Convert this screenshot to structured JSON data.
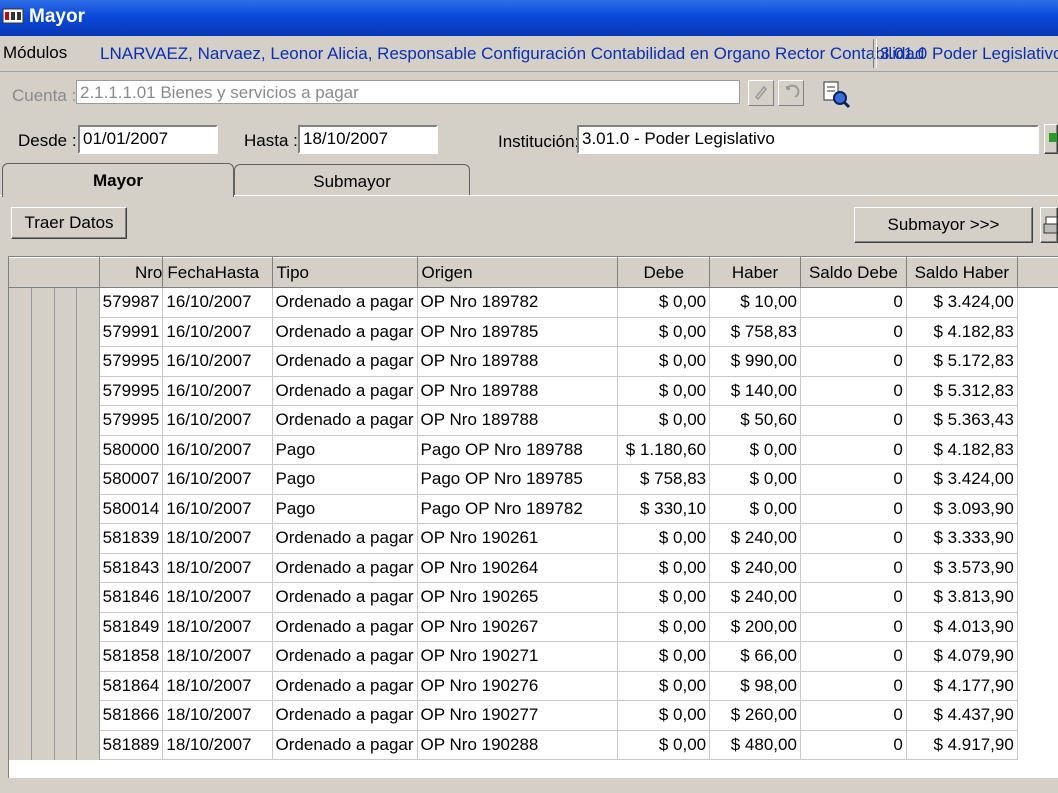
{
  "window": {
    "title": "Mayor"
  },
  "modules": {
    "label": "Módulos",
    "user": "LNARVAEZ, Narvaez, Leonor Alicia, Responsable Configuración Contabilidad en Organo Rector Contabilidad",
    "org": "3.01.0 Poder Legislativo,"
  },
  "cuenta": {
    "label": "Cuenta :",
    "value": "2.1.1.1.01 Bienes y servicios a pagar"
  },
  "filters": {
    "desde_label": "Desde :",
    "desde_value": "01/01/2007",
    "hasta_label": "Hasta :",
    "hasta_value": "18/10/2007",
    "institucion_label": "Institución:",
    "institucion_value": "3.01.0 - Poder Legislativo"
  },
  "tabs": [
    {
      "label": "Mayor"
    },
    {
      "label": "Submayor"
    }
  ],
  "buttons": {
    "traer_datos": "Traer Datos",
    "submayor": "Submayor >>>"
  },
  "table": {
    "columns": [
      "Nro",
      "FechaHasta",
      "Tipo",
      "Origen",
      "Debe",
      "Haber",
      "Saldo Debe",
      "Saldo Haber"
    ],
    "rows": [
      [
        "579987",
        "16/10/2007",
        "Ordenado a pagar",
        "OP Nro 189782",
        "$ 0,00",
        "$ 10,00",
        "0",
        "$ 3.424,00"
      ],
      [
        "579991",
        "16/10/2007",
        "Ordenado a pagar",
        "OP Nro 189785",
        "$ 0,00",
        "$ 758,83",
        "0",
        "$ 4.182,83"
      ],
      [
        "579995",
        "16/10/2007",
        "Ordenado a pagar",
        "OP Nro 189788",
        "$ 0,00",
        "$ 990,00",
        "0",
        "$ 5.172,83"
      ],
      [
        "579995",
        "16/10/2007",
        "Ordenado a pagar",
        "OP Nro 189788",
        "$ 0,00",
        "$ 140,00",
        "0",
        "$ 5.312,83"
      ],
      [
        "579995",
        "16/10/2007",
        "Ordenado a pagar",
        "OP Nro 189788",
        "$ 0,00",
        "$ 50,60",
        "0",
        "$ 5.363,43"
      ],
      [
        "580000",
        "16/10/2007",
        "Pago",
        "Pago OP Nro  189788",
        "$ 1.180,60",
        "$ 0,00",
        "0",
        "$ 4.182,83"
      ],
      [
        "580007",
        "16/10/2007",
        "Pago",
        "Pago OP Nro  189785",
        "$ 758,83",
        "$ 0,00",
        "0",
        "$ 3.424,00"
      ],
      [
        "580014",
        "16/10/2007",
        "Pago",
        "Pago OP Nro  189782",
        "$ 330,10",
        "$ 0,00",
        "0",
        "$ 3.093,90"
      ],
      [
        "581839",
        "18/10/2007",
        "Ordenado a pagar",
        "OP Nro 190261",
        "$ 0,00",
        "$ 240,00",
        "0",
        "$ 3.333,90"
      ],
      [
        "581843",
        "18/10/2007",
        "Ordenado a pagar",
        "OP Nro 190264",
        "$ 0,00",
        "$ 240,00",
        "0",
        "$ 3.573,90"
      ],
      [
        "581846",
        "18/10/2007",
        "Ordenado a pagar",
        "OP Nro 190265",
        "$ 0,00",
        "$ 240,00",
        "0",
        "$ 3.813,90"
      ],
      [
        "581849",
        "18/10/2007",
        "Ordenado a pagar",
        "OP Nro 190267",
        "$ 0,00",
        "$ 200,00",
        "0",
        "$ 4.013,90"
      ],
      [
        "581858",
        "18/10/2007",
        "Ordenado a pagar",
        "OP Nro 190271",
        "$ 0,00",
        "$ 66,00",
        "0",
        "$ 4.079,90"
      ],
      [
        "581864",
        "18/10/2007",
        "Ordenado a pagar",
        "OP Nro 190276",
        "$ 0,00",
        "$ 98,00",
        "0",
        "$ 4.177,90"
      ],
      [
        "581866",
        "18/10/2007",
        "Ordenado a pagar",
        "OP Nro 190277",
        "$ 0,00",
        "$ 260,00",
        "0",
        "$ 4.437,90"
      ],
      [
        "581889",
        "18/10/2007",
        "Ordenado a pagar",
        "OP Nro 190288",
        "$ 0,00",
        "$ 480,00",
        "0",
        "$ 4.917,90"
      ]
    ]
  },
  "colors": {
    "title_bar": "#0a48d8",
    "link_text": "#0c2fb0",
    "face": "#d4d0c8"
  }
}
